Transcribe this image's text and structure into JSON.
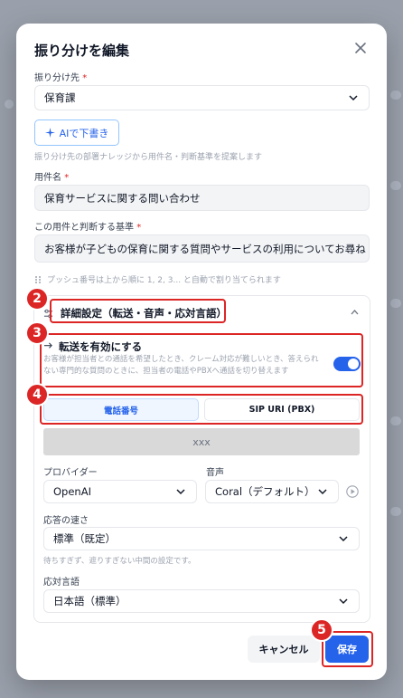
{
  "modal": {
    "title": "振り分けを編集"
  },
  "destination": {
    "label": "振り分け先",
    "required_mark": "*",
    "value": "保育課"
  },
  "ai_button": {
    "label": "AIで下書き",
    "hint": "振り分け先の部署ナレッジから用件名・判断基準を提案します"
  },
  "subject": {
    "label": "用件名",
    "required_mark": "*",
    "value": "保育サービスに関する問い合わせ"
  },
  "criteria": {
    "label": "この用件と判断する基準",
    "required_mark": "*",
    "value": "お客様が子どもの保育に関する質問やサービスの利用についてお尋ね"
  },
  "push_hint": "プッシュ番号は上から順に 1, 2, 3... と自動で割り当てられます",
  "advanced": {
    "title": "詳細設定（転送・音声・応対言語）",
    "transfer_title": "転送を有効にする",
    "transfer_desc": "お客様が担当者との通話を希望したとき、クレーム対応が難しいとき、答えられない専門的な質問のときに、担当者の電話やPBXへ通話を切り替えます",
    "transfer_enabled": true,
    "tab_phone": "電話番号",
    "tab_sip": "SIP URI (PBX)",
    "phone_value": "xxx",
    "provider_label": "プロバイダー",
    "provider_value": "OpenAI",
    "voice_label": "音声",
    "voice_value": "Coral（デフォルト）",
    "speed_label": "応答の速さ",
    "speed_value": "標準（既定）",
    "speed_hint": "待ちすぎず、遮りすぎない中間の設定です。",
    "language_label": "応対言語",
    "language_value": "日本語（標準）"
  },
  "footer": {
    "cancel_label": "キャンセル",
    "save_label": "保存"
  },
  "annotations": {
    "badge2": "2",
    "badge3": "3",
    "badge4": "4",
    "badge5": "5"
  },
  "colors": {
    "accent": "#2563eb",
    "highlight": "#dc2626"
  }
}
